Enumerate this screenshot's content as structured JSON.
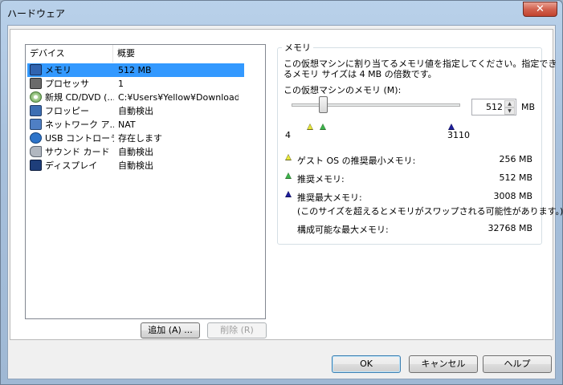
{
  "window": {
    "title": "ハードウェア",
    "close_glyph": "✕"
  },
  "device_list": {
    "columns": [
      "デバイス",
      "概要"
    ],
    "rows": [
      {
        "name": "メモリ",
        "summary": "512 MB",
        "icon": "memory-icon",
        "selected": true
      },
      {
        "name": "プロセッサ",
        "summary": "1",
        "icon": "processor-icon",
        "selected": false
      },
      {
        "name": "新規 CD/DVD (...",
        "summary": "C:¥Users¥Yellow¥Downloads...",
        "icon": "cd-dvd-icon",
        "selected": false
      },
      {
        "name": "フロッピー",
        "summary": "自動検出",
        "icon": "floppy-icon",
        "selected": false
      },
      {
        "name": "ネットワーク ア...",
        "summary": "NAT",
        "icon": "network-adapter-icon",
        "selected": false
      },
      {
        "name": "USB コントローラ",
        "summary": "存在します",
        "icon": "usb-icon",
        "selected": false
      },
      {
        "name": "サウンド カード",
        "summary": "自動検出",
        "icon": "sound-card-icon",
        "selected": false
      },
      {
        "name": "ディスプレイ",
        "summary": "自動検出",
        "icon": "display-icon",
        "selected": false
      }
    ]
  },
  "list_buttons": {
    "add": "追加 (A) ...",
    "remove": "削除 (R)"
  },
  "memory": {
    "group_label": "メモリ",
    "description_line1": "この仮想マシンに割り当てるメモリ値を指定してください。指定でき",
    "description_line2": "るメモリ サイズは 4 MB の倍数です。",
    "vm_memory_label": "この仮想マシンのメモリ (M):",
    "value": "512",
    "unit": "MB",
    "slider_min_label": "4",
    "slider_max_label": "3110",
    "guest_min_label": "ゲスト OS の推奨最小メモリ:",
    "guest_min_value": "256 MB",
    "recommended_label": "推奨メモリ:",
    "recommended_value": "512 MB",
    "max_recommended_label": "推奨最大メモリ:",
    "max_recommended_value": "3008 MB",
    "swap_note": "(このサイズを超えるとメモリがスワップされる可能性があります。)",
    "max_config_label": "構成可能な最大メモリ:",
    "max_config_value": "32768 MB",
    "marker_colors": {
      "min": "#e8e83a",
      "recommended": "#3cb44b",
      "max": "#1e1e9c"
    }
  },
  "dialog_buttons": {
    "ok": "OK",
    "cancel": "キャンセル",
    "help": "ヘルプ"
  }
}
